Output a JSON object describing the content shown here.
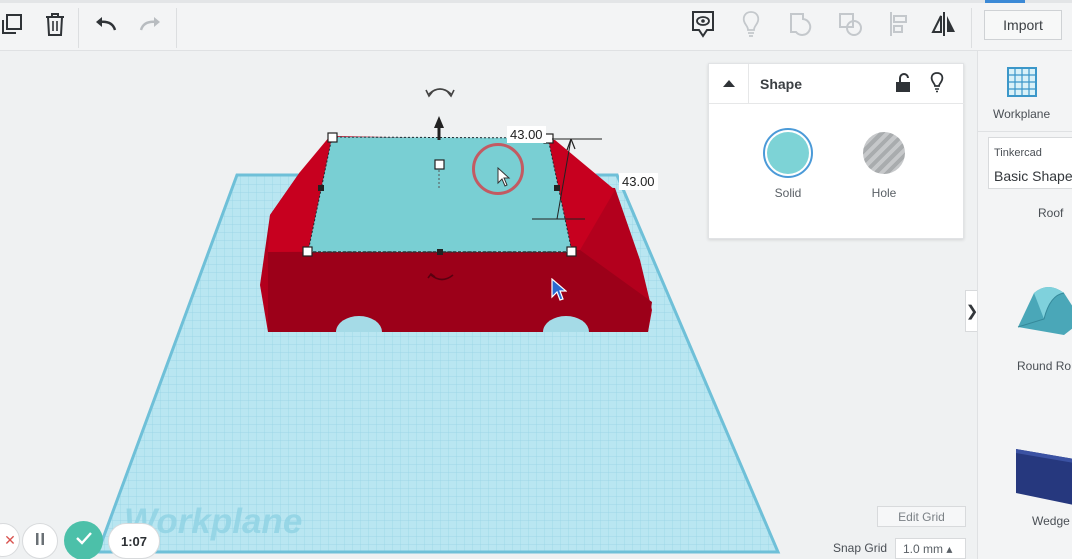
{
  "toolbar": {
    "left_tools": [
      "copy-icon",
      "trash-icon",
      "undo-icon",
      "redo-icon"
    ],
    "right_tools": [
      "view-icon",
      "bulb-icon",
      "group-icon",
      "ungroup-icon",
      "align-icon",
      "mirror-icon"
    ],
    "import_label": "Import"
  },
  "inspector": {
    "title": "Shape",
    "solid_label": "Solid",
    "hole_label": "Hole",
    "solid_color": "#7dd3d6"
  },
  "workspace": {
    "dimension_width": "43.00",
    "dimension_height": "43.00",
    "workplane_watermark": "Workplane"
  },
  "library": {
    "workplane_label": "Workplane",
    "source_label": "Tinkercad",
    "category": "Basic Shape",
    "items": [
      {
        "label": "Roof"
      },
      {
        "label": "Round Ro"
      },
      {
        "label": "Wedge"
      }
    ]
  },
  "grid": {
    "edit_label": "Edit Grid",
    "snap_label": "Snap Grid",
    "snap_value": "1.0 mm ▴"
  },
  "recorder": {
    "time": "1:07"
  },
  "colors": {
    "accent": "#3b89d6",
    "car_body": "#c4001f",
    "roof_shape": "#76cfd2",
    "grid": "#a9dbe9",
    "confirm": "#4cc0a9"
  }
}
